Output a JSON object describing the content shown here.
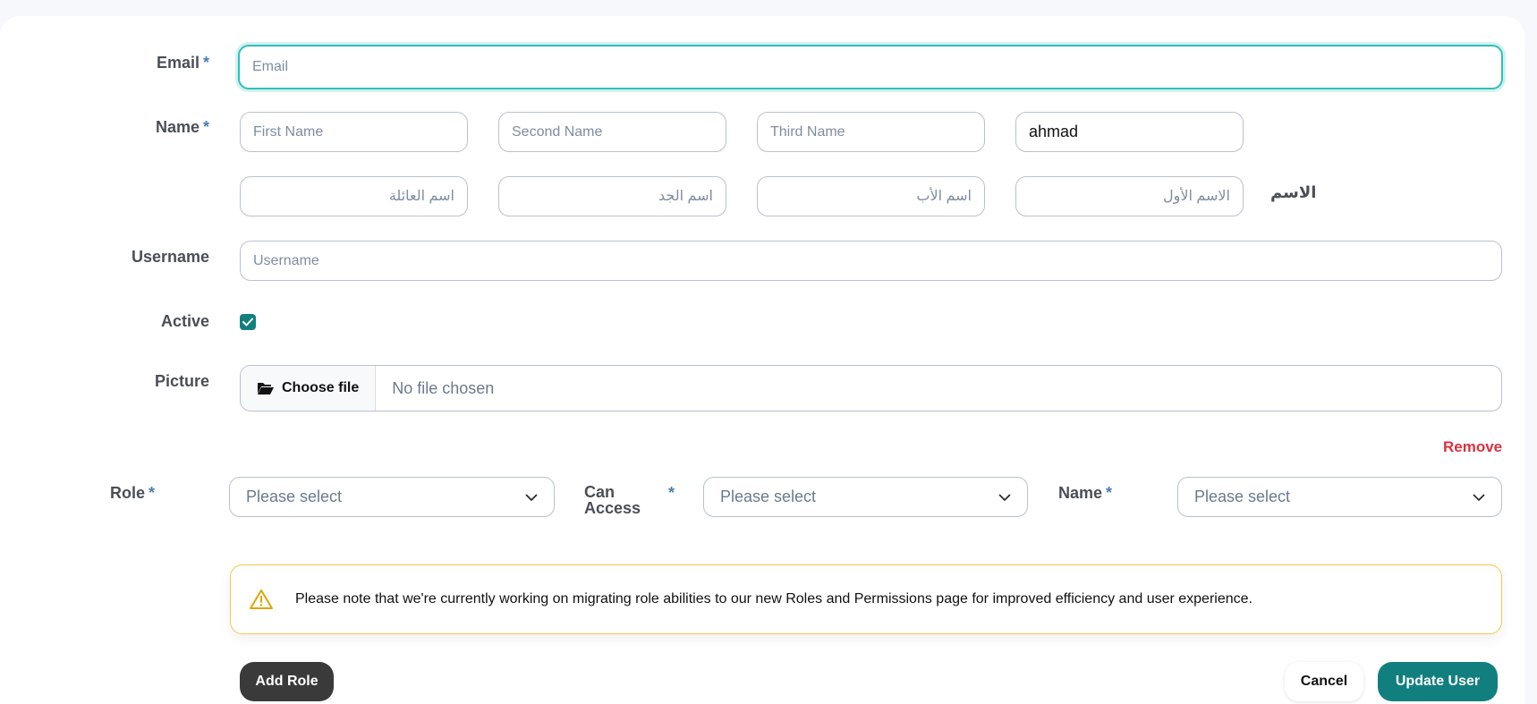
{
  "form": {
    "email": {
      "label": "Email",
      "required": "*",
      "placeholder": "Email",
      "value": ""
    },
    "name": {
      "label": "Name",
      "required": "*",
      "first_placeholder": "First Name",
      "second_placeholder": "Second Name",
      "third_placeholder": "Third Name",
      "fourth_value": "ahmad"
    },
    "arabic_name": {
      "label": "الاسم",
      "family_placeholder": "اسم العائلة",
      "grandfather_placeholder": "اسم الجد",
      "father_placeholder": "اسم الأب",
      "first_placeholder": "الاسم الأول"
    },
    "username": {
      "label": "Username",
      "placeholder": "Username"
    },
    "active": {
      "label": "Active",
      "checked": true
    },
    "picture": {
      "label": "Picture",
      "button_label": "Choose file",
      "status": "No file chosen"
    },
    "remove_label": "Remove",
    "role_row": {
      "role_label": "Role",
      "role_required": "*",
      "role_value": "Please select",
      "access_label_line1": "Can",
      "access_label_line2": "Access",
      "access_required": "*",
      "access_value": "Please select",
      "name_label": "Name",
      "name_required": "*",
      "name_value": "Please select"
    },
    "notice": "Please note that we're currently working on migrating role abilities to our new Roles and Permissions page for improved efficiency and user experience.",
    "buttons": {
      "add_role": "Add Role",
      "cancel": "Cancel",
      "update": "Update User"
    }
  },
  "colors": {
    "accent": "#127f7f",
    "focus": "#2ec0b8",
    "danger": "#d9323f",
    "warning": "#f2c94c"
  }
}
